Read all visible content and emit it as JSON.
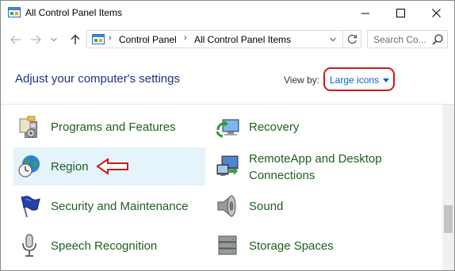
{
  "window": {
    "title": "All Control Panel Items",
    "icon": "control-panel-icon"
  },
  "nav": {
    "breadcrumb": [
      "Control Panel",
      "All Control Panel Items"
    ],
    "search_placeholder": "Search Co..."
  },
  "header": {
    "title": "Adjust your computer's settings",
    "view_by_label": "View by:",
    "view_by_value": "Large icons"
  },
  "items": [
    {
      "label": "Programs and Features",
      "icon": "programs-features-icon"
    },
    {
      "label": "Recovery",
      "icon": "recovery-icon"
    },
    {
      "label": "Region",
      "icon": "region-globe-clock-icon",
      "highlighted": true
    },
    {
      "label_line1": "RemoteApp and Desktop",
      "label_line2": "Connections",
      "icon": "remoteapp-icon"
    },
    {
      "label": "Security and Maintenance",
      "icon": "security-flag-icon"
    },
    {
      "label": "Sound",
      "icon": "speaker-icon"
    },
    {
      "label": "Speech Recognition",
      "icon": "microphone-icon"
    },
    {
      "label": "Storage Spaces",
      "icon": "storage-spaces-icon"
    }
  ],
  "colors": {
    "link_green": "#1f5e1f",
    "heading_blue": "#1e3287",
    "view_by_blue": "#0066cc",
    "annotation_red": "#d0161b",
    "highlight_bg": "#e5f3fb"
  }
}
